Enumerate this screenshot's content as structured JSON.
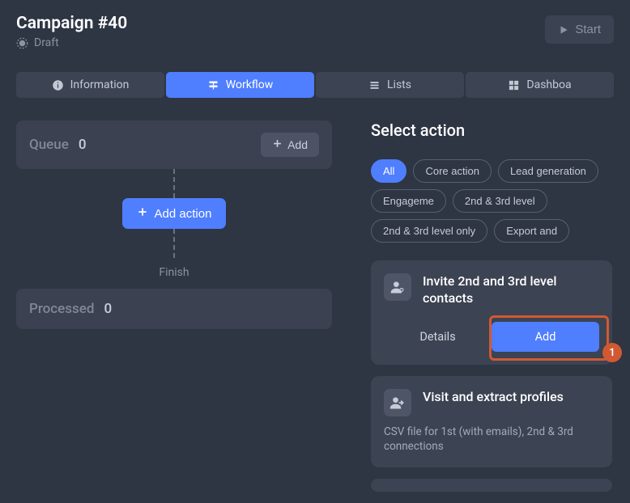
{
  "header": {
    "title": "Campaign #40",
    "status": "Draft",
    "start_label": "Start"
  },
  "tabs": {
    "information": "Information",
    "workflow": "Workflow",
    "lists": "Lists",
    "dashboard": "Dashboa"
  },
  "workflow": {
    "queue_label": "Queue",
    "queue_count": "0",
    "add_label": "Add",
    "add_action_label": "Add action",
    "finish_label": "Finish",
    "processed_label": "Processed",
    "processed_count": "0"
  },
  "select_action": {
    "title": "Select action",
    "chips": {
      "all": "All",
      "core": "Core action",
      "leadgen": "Lead generation",
      "engagement": "Engageme",
      "lvl23": "2nd & 3rd level",
      "lvl23only": "2nd & 3rd level only",
      "export": "Export and"
    },
    "card1": {
      "title": "Invite 2nd and 3rd level contacts",
      "details": "Details",
      "add": "Add"
    },
    "card2": {
      "title": "Visit and extract profiles",
      "desc": "CSV file for 1st (with emails), 2nd & 3rd connections"
    },
    "badge": "1"
  }
}
